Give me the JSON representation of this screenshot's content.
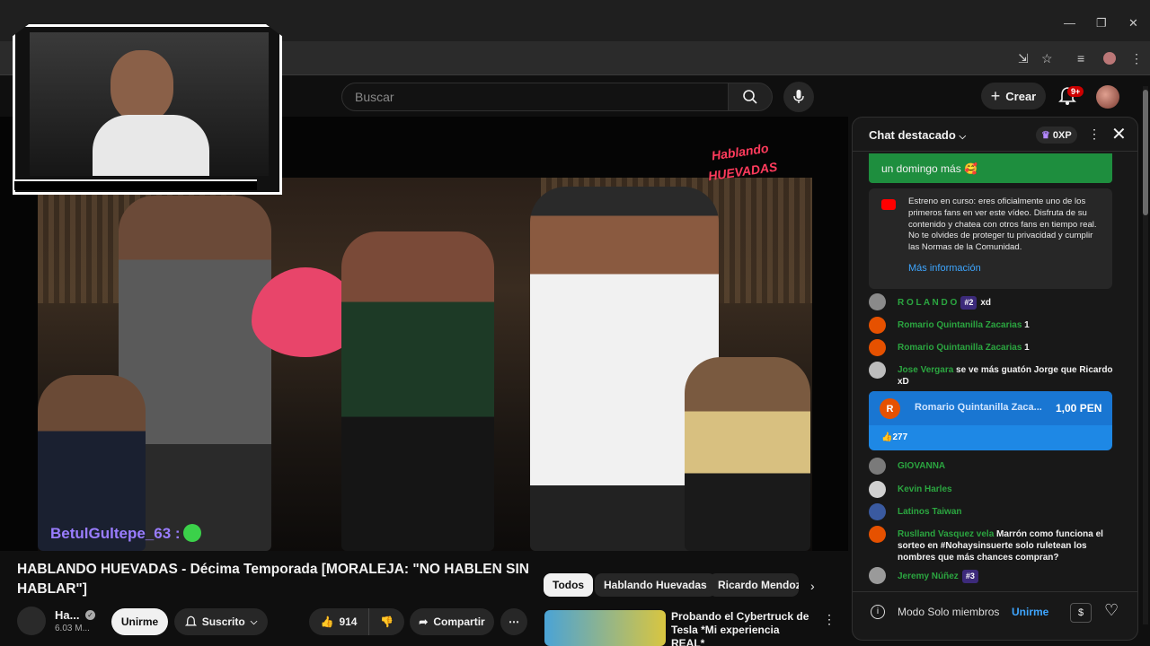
{
  "header": {
    "search_placeholder": "Buscar",
    "create_label": "Crear",
    "notif_count": "9+"
  },
  "video": {
    "watermark": "Hablando HUEVADAS",
    "overlay_user": "BetulGultepe_63 :",
    "title": "HABLANDO HUEVADAS - Décima Temporada [MORALEJA: \"NO HABLEN SIN HABLAR\"]",
    "channel_name": "Ha...",
    "channel_subs": "6.03 M...",
    "join_label": "Unirme",
    "subscribed_label": "Suscrito",
    "like_count": "914",
    "share_label": "Compartir"
  },
  "chips": [
    "Todos",
    "Hablando Huevadas",
    "Ricardo Mendoza"
  ],
  "recommendation": {
    "title": "Probando el Cybertruck de Tesla *Mi experiencia REAL*"
  },
  "chat": {
    "title": "Chat destacado",
    "xp": "0XP",
    "pinned": "un domingo más 🥰",
    "notice": "Estreno en curso: eres oficialmente uno de los primeros fans en ver este vídeo. Disfruta de su contenido y chatea con otros fans en tiempo real. No te olvides de proteger tu privacidad y cumplir las Normas de la Comunidad.",
    "notice_link": "Más información",
    "messages": [
      {
        "name": "R O L A N D O",
        "badge": "#2",
        "text": "xd",
        "avatar_color": "#8a8a8a"
      },
      {
        "name": "Romario Quintanilla Zacarias",
        "badge": "",
        "text": "1",
        "avatar_color": "#e65100"
      },
      {
        "name": "Romario Quintanilla Zacarias",
        "badge": "",
        "text": "1",
        "avatar_color": "#e65100"
      },
      {
        "name": "Jose Vergara",
        "badge": "",
        "text": "se ve más guatón Jorge que Ricardo xD",
        "avatar_color": "#bdbdbd"
      },
      {
        "name": "GIOVANNA",
        "badge": "",
        "text": "",
        "avatar_color": "#7a7a7a"
      },
      {
        "name": "Kevin Harles",
        "badge": "",
        "text": "",
        "avatar_color": "#d0d0d0"
      },
      {
        "name": "Latinos Taiwan",
        "badge": "",
        "text": "",
        "avatar_color": "#3a5aa0"
      },
      {
        "name": "Ruslland Vasquez vela",
        "badge": "",
        "text": "Marrón como funciona el sorteo en #Nohaysinsuerte solo ruletean los nombres que más chances compran?",
        "avatar_color": "#e65100"
      },
      {
        "name": "Jeremy Núñez",
        "badge": "#3",
        "text": "",
        "avatar_color": "#9a9a9a"
      }
    ],
    "superchat": {
      "initial": "R",
      "name": "Romario Quintanilla Zaca...",
      "amount": "1,00 PEN",
      "likes": "277"
    },
    "footer_label": "Modo Solo miembros",
    "footer_join": "Unirme"
  },
  "colors": {
    "accent_green": "#1e8e3e",
    "superchat_blue": "#1e88e5",
    "link_blue": "#3ea6ff"
  }
}
